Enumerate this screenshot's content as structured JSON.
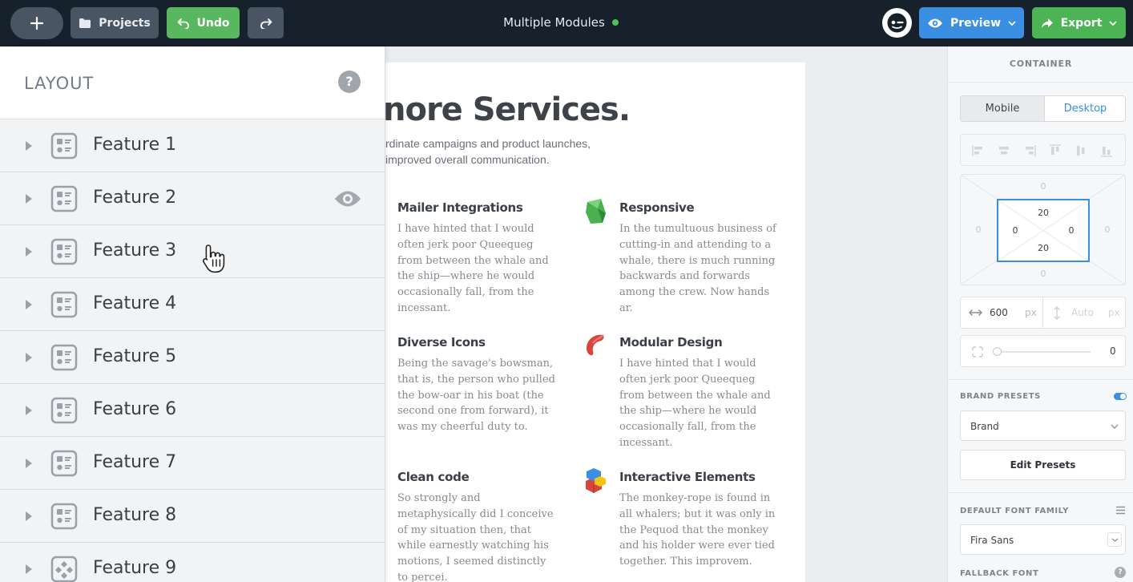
{
  "topbar": {
    "projects_label": "Projects",
    "undo_label": "Undo",
    "doc_title": "Multiple Modules",
    "preview_label": "Preview",
    "export_label": "Export",
    "status_color": "#4cc35a"
  },
  "layout_panel": {
    "title": "LAYOUT",
    "help": "?",
    "rows": [
      {
        "label": "Feature 1"
      },
      {
        "label": "Feature 2"
      },
      {
        "label": "Feature 3"
      },
      {
        "label": "Feature 4"
      },
      {
        "label": "Feature 5"
      },
      {
        "label": "Feature 6"
      },
      {
        "label": "Feature 7"
      },
      {
        "label": "Feature 8"
      },
      {
        "label": "Feature 9"
      }
    ]
  },
  "page": {
    "heading": "nore Services.",
    "subtitle_line1": "rdinate campaigns and product launches,",
    "subtitle_line2": "improved overall communication.",
    "features": [
      {
        "title": "Mailer Integrations",
        "icon": "none",
        "text": "I have hinted that I would often jerk poor Queequeg from between the whale and the ship—where he would occasionally fall, from the incessant."
      },
      {
        "title": "Responsive",
        "icon": "green-gem-icon",
        "text": "In the tumultuous business of cutting-in and attending to a whale, there is much running backwards and forwards among the crew. Now hands ar."
      },
      {
        "title": "Diverse Icons",
        "icon": "none",
        "text": "Being the savage's bowsman, that is, the person who pulled the bow-oar in his boat (the second one from forward), it was my cheerful duty to."
      },
      {
        "title": "Modular Design",
        "icon": "red-arc-icon",
        "text": "I have hinted that I would often jerk poor Queequeg from between the whale and the ship—where he would occasionally fall, from the incessant."
      },
      {
        "title": "Clean code",
        "icon": "none",
        "text": "So strongly and metaphysically did I conceive of my situation then, that while earnestly watching his motions, I seemed distinctly to percei."
      },
      {
        "title": "Interactive Elements",
        "icon": "stacked-blocks-icon",
        "text": "The monkey-rope is found in all whalers; but it was only in the Pequod that the monkey and his holder were ever tied together. This improvem."
      }
    ]
  },
  "inspector": {
    "title": "CONTAINER",
    "mobile_label": "Mobile",
    "desktop_label": "Desktop",
    "margin": {
      "top": "0",
      "right": "0",
      "bottom": "0",
      "left": "0"
    },
    "padding": {
      "top": "20",
      "right": "0",
      "bottom": "20",
      "left": "0"
    },
    "width_value": "600",
    "width_unit": "px",
    "height_placeholder": "Auto",
    "height_unit": "px",
    "radius_value": "0",
    "brand_presets_label": "BRAND PRESETS",
    "brand_value": "Brand",
    "edit_presets_label": "Edit Presets",
    "font_family_label": "DEFAULT FONT FAMILY",
    "font_family_value": "Fira Sans",
    "fallback_label": "FALLBACK FONT",
    "accent_color": "#3b8fe2"
  }
}
